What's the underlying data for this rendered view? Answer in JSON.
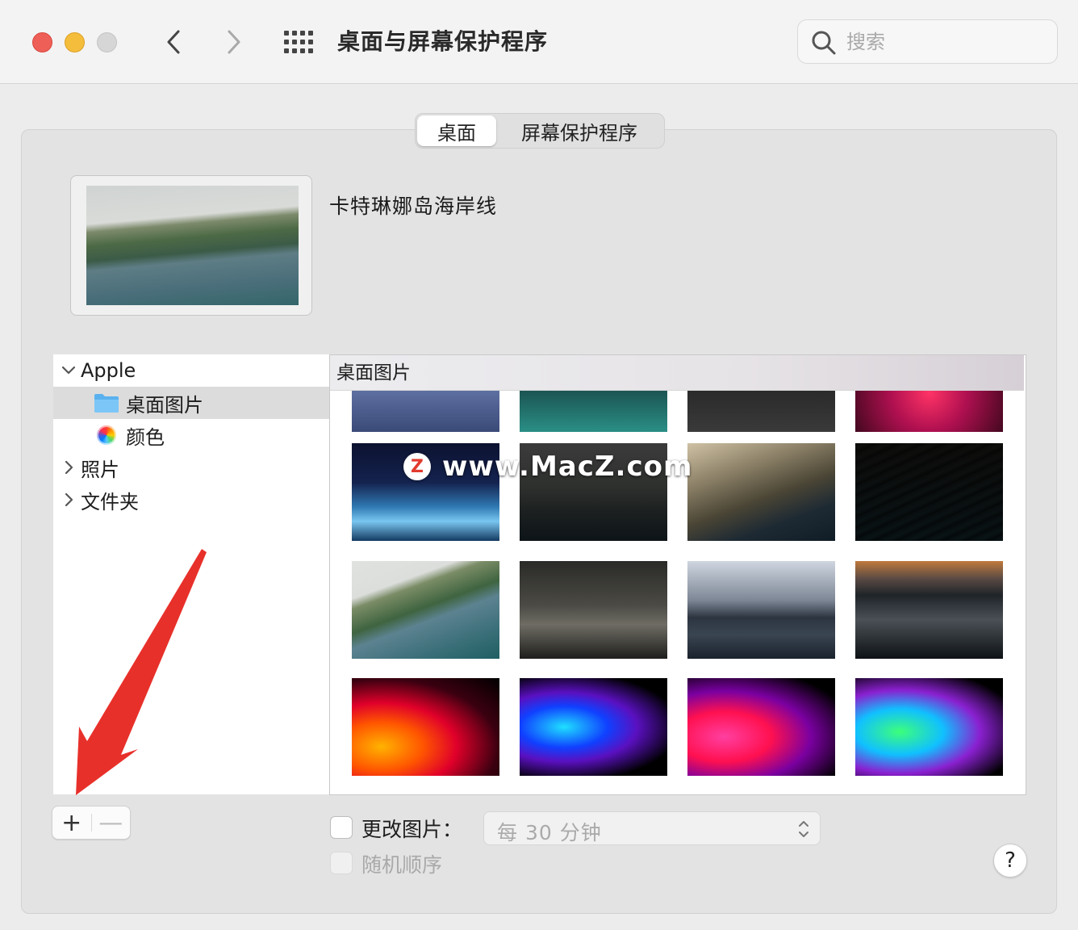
{
  "window": {
    "title": "桌面与屏幕保护程序",
    "search_placeholder": "搜索"
  },
  "tabs": [
    {
      "label": "桌面",
      "active": true
    },
    {
      "label": "屏幕保护程序",
      "active": false
    }
  ],
  "current_wallpaper": {
    "name": "卡特琳娜岛海岸线"
  },
  "sidebar": {
    "items": [
      {
        "label": "Apple",
        "expanded": true,
        "icon": "chevron-down-icon"
      },
      {
        "label": "桌面图片",
        "selected": true,
        "icon": "folder-icon"
      },
      {
        "label": "颜色",
        "icon": "color-wheel-icon"
      },
      {
        "label": "照片",
        "expanded": false,
        "icon": "chevron-right-icon"
      },
      {
        "label": "文件夹",
        "expanded": false,
        "icon": "chevron-right-icon"
      }
    ]
  },
  "grid": {
    "header": "桌面图片",
    "thumbnails": [
      "blue-stones",
      "teal-coast",
      "night-road",
      "red-plant",
      "blue-grass",
      "dark-cliff",
      "sunlit-cliff",
      "striped-cliff",
      "catalina-coastline",
      "stormy-sea",
      "island-clouds",
      "foggy-coast",
      "macbook-pro-orange",
      "macbook-pro-blue",
      "macbook-pro-pink",
      "macbook-pro-green"
    ]
  },
  "watermark": {
    "badge": "Z",
    "text": "www.MacZ.com"
  },
  "controls": {
    "add_label": "+",
    "remove_label": "—",
    "change_picture_label": "更改图片：",
    "interval_value": "每 30 分钟",
    "random_order_label": "随机顺序",
    "help_label": "?"
  },
  "colors": {
    "close": "#ee5f57",
    "minimize": "#f4bd3b",
    "annotation_arrow": "#e8302a"
  }
}
